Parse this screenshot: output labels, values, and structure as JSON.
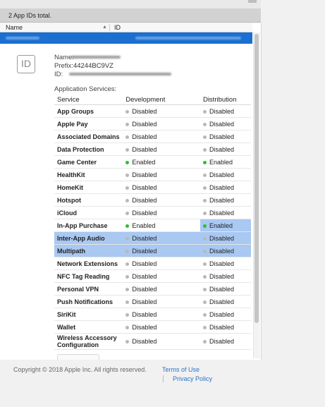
{
  "list": {
    "count_text": "2 App IDs total.",
    "columns": [
      "Name",
      "ID"
    ],
    "sort_indicator": "▲"
  },
  "detail": {
    "icon_text": "ID",
    "name_label": "Name:",
    "prefix_label": "Prefix:",
    "prefix_value": "44244BC9VZ",
    "id_label": "ID:",
    "services_title": "Application Services:",
    "table_headers": [
      "Service",
      "Development",
      "Distribution"
    ],
    "services": [
      {
        "name": "App Groups",
        "dev": "Disabled",
        "dist": "Disabled",
        "dev_on": false,
        "dist_on": false
      },
      {
        "name": "Apple Pay",
        "dev": "Disabled",
        "dist": "Disabled",
        "dev_on": false,
        "dist_on": false
      },
      {
        "name": "Associated Domains",
        "dev": "Disabled",
        "dist": "Disabled",
        "dev_on": false,
        "dist_on": false
      },
      {
        "name": "Data Protection",
        "dev": "Disabled",
        "dist": "Disabled",
        "dev_on": false,
        "dist_on": false
      },
      {
        "name": "Game Center",
        "dev": "Enabled",
        "dist": "Enabled",
        "dev_on": true,
        "dist_on": true
      },
      {
        "name": "HealthKit",
        "dev": "Disabled",
        "dist": "Disabled",
        "dev_on": false,
        "dist_on": false
      },
      {
        "name": "HomeKit",
        "dev": "Disabled",
        "dist": "Disabled",
        "dev_on": false,
        "dist_on": false
      },
      {
        "name": "Hotspot",
        "dev": "Disabled",
        "dist": "Disabled",
        "dev_on": false,
        "dist_on": false
      },
      {
        "name": "iCloud",
        "dev": "Disabled",
        "dist": "Disabled",
        "dev_on": false,
        "dist_on": false
      },
      {
        "name": "In-App Purchase",
        "dev": "Enabled",
        "dist": "Enabled",
        "dev_on": true,
        "dist_on": true
      },
      {
        "name": "Inter-App Audio",
        "dev": "Disabled",
        "dist": "Disabled",
        "dev_on": false,
        "dist_on": false
      },
      {
        "name": "Multipath",
        "dev": "Disabled",
        "dist": "Disabled",
        "dev_on": false,
        "dist_on": false
      },
      {
        "name": "Network Extensions",
        "dev": "Disabled",
        "dist": "Disabled",
        "dev_on": false,
        "dist_on": false
      },
      {
        "name": "NFC Tag Reading",
        "dev": "Disabled",
        "dist": "Disabled",
        "dev_on": false,
        "dist_on": false
      },
      {
        "name": "Personal VPN",
        "dev": "Disabled",
        "dist": "Disabled",
        "dev_on": false,
        "dist_on": false
      },
      {
        "name": "Push Notifications",
        "dev": "Disabled",
        "dist": "Disabled",
        "dev_on": false,
        "dist_on": false
      },
      {
        "name": "SiriKit",
        "dev": "Disabled",
        "dist": "Disabled",
        "dev_on": false,
        "dist_on": false
      },
      {
        "name": "Wallet",
        "dev": "Disabled",
        "dist": "Disabled",
        "dev_on": false,
        "dist_on": false
      },
      {
        "name": "Wireless Accessory Configuration",
        "dev": "Disabled",
        "dist": "Disabled",
        "dev_on": false,
        "dist_on": false
      }
    ]
  },
  "footer": {
    "copyright": "Copyright © 2018 Apple Inc. All rights reserved.",
    "terms": "Terms of Use",
    "privacy": "Privacy Policy"
  },
  "colors": {
    "selection": "#1a6fd1",
    "enabled_dot": "#2cbf2c",
    "disabled_dot": "#b8b8b8",
    "text_highlight": "#a9c8f2",
    "link": "#2a74c4"
  }
}
